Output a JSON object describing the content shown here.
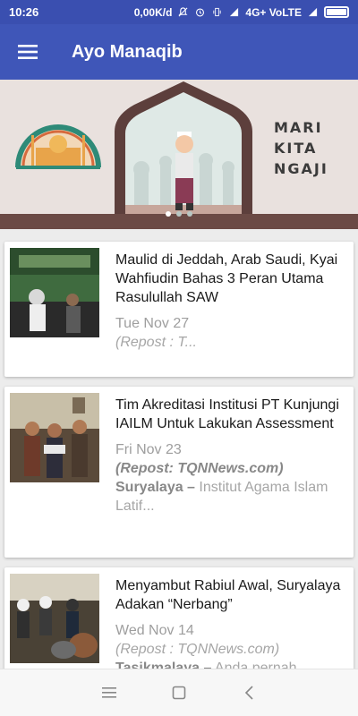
{
  "status": {
    "time": "10:26",
    "network_speed": "0,00K/d",
    "network_type": "4G+ VoLTE"
  },
  "appbar": {
    "title": "Ayo Manaqib",
    "menu_icon": "hamburger-menu-icon"
  },
  "banner": {
    "line1": "MARI",
    "line2": "KITA",
    "line3": "NGAJI",
    "page_count": 3,
    "active_page": 1
  },
  "articles": [
    {
      "title": "Maulid di Jeddah, Arab Saudi, Kyai Wahfiudin Bahas 3 Peran Utama Rasulullah SAW",
      "date": "Tue Nov 27",
      "excerpt_italic": "(Repost : T...",
      "excerpt_bold": "",
      "excerpt_rest": ""
    },
    {
      "title": "Tim Akreditasi Institusi PT Kunjungi IAILM Untuk Lakukan Assessment",
      "date": "Fri Nov 23",
      "excerpt_italic": "(Repost: TQNNews.com)",
      "excerpt_bold": "Suryalaya –",
      "excerpt_rest": " Institut Agama Islam Latif..."
    },
    {
      "title": "Menyambut Rabiul Awal, Suryalaya Adakan “Nerbang”",
      "date": "Wed Nov 14",
      "excerpt_italic": "(Repost : TQNNews.com)",
      "excerpt_bold": "Tasikmalaya –",
      "excerpt_rest": " Anda pernah"
    }
  ],
  "colors": {
    "primary": "#3f56b8",
    "statusbar": "#3a4fb0",
    "background": "#ececec"
  }
}
